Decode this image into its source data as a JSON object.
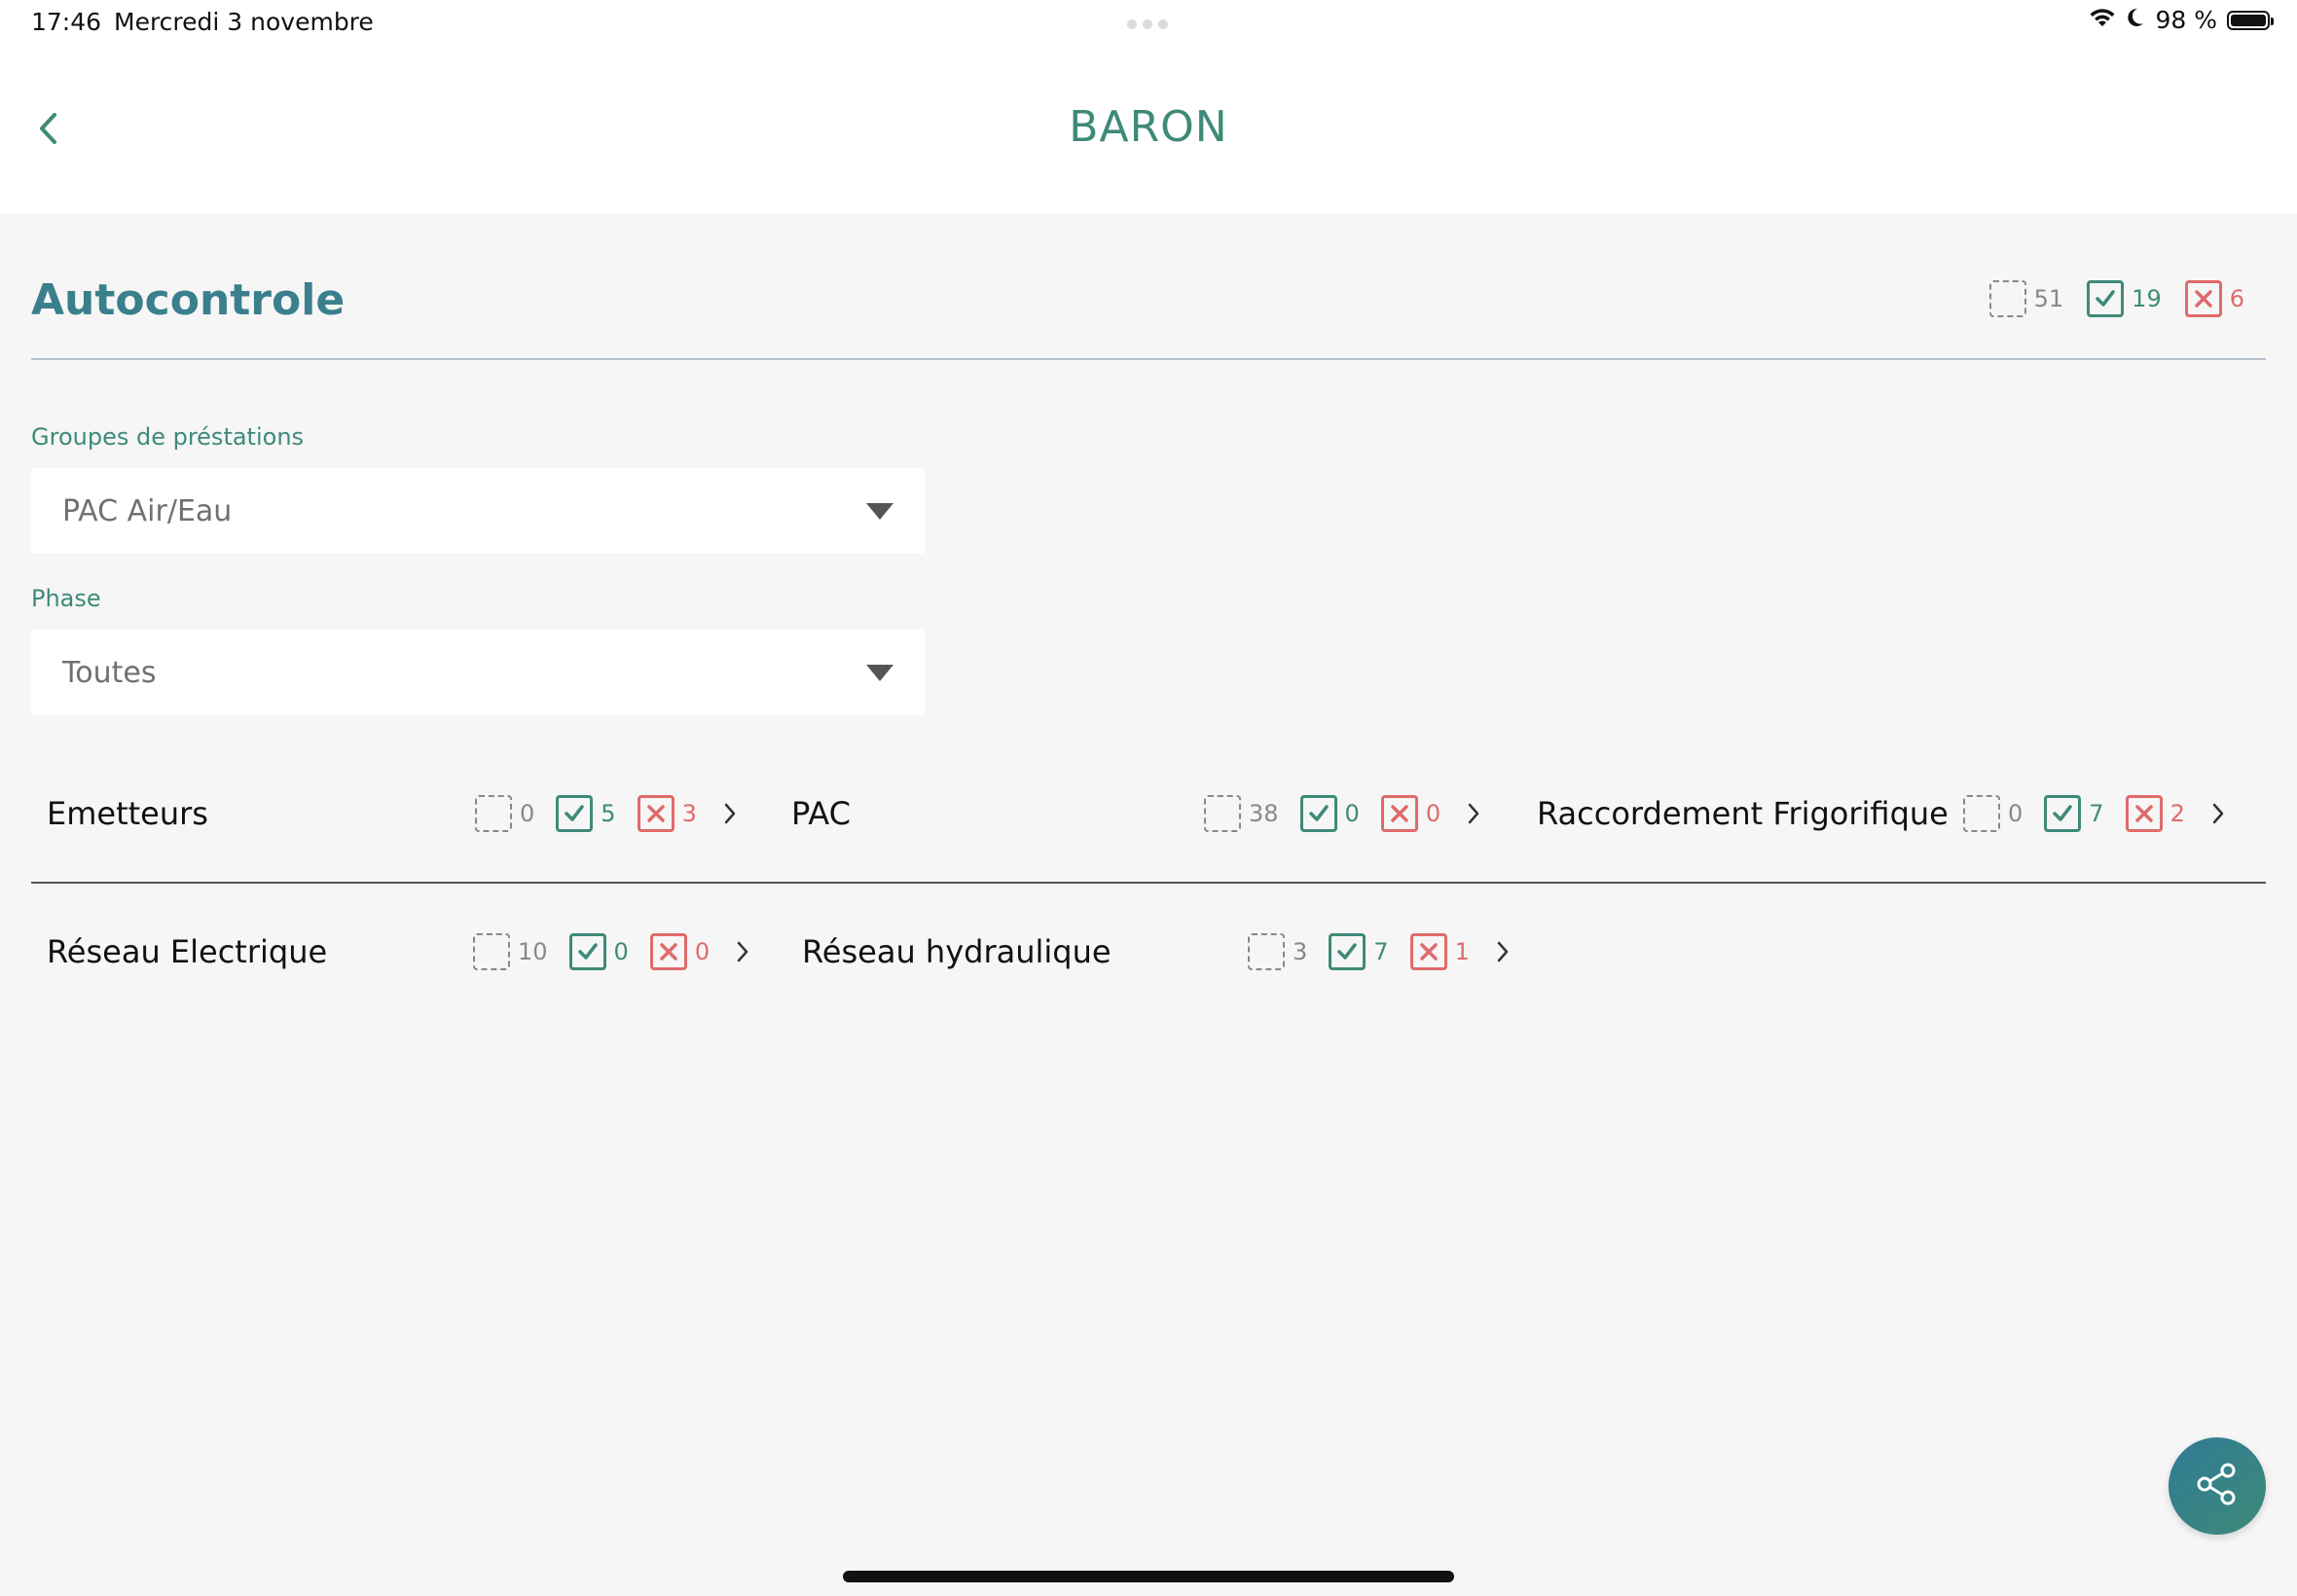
{
  "status_bar": {
    "time": "17:46",
    "date": "Mercredi 3 novembre",
    "battery": "98 %"
  },
  "header": {
    "title": "BARON"
  },
  "section": {
    "title": "Autocontrole",
    "summary": {
      "pending": "51",
      "ok": "19",
      "ko": "6"
    }
  },
  "filters": {
    "group_label": "Groupes de préstations",
    "group_value": "PAC Air/Eau",
    "phase_label": "Phase",
    "phase_value": "Toutes"
  },
  "categories": [
    {
      "name": "Emetteurs",
      "pending": "0",
      "ok": "5",
      "ko": "3"
    },
    {
      "name": "PAC",
      "pending": "38",
      "ok": "0",
      "ko": "0"
    },
    {
      "name": "Raccordement Frigorifique",
      "pending": "0",
      "ok": "7",
      "ko": "2"
    },
    {
      "name": "Réseau Electrique",
      "pending": "10",
      "ok": "0",
      "ko": "0"
    },
    {
      "name": "Réseau hydraulique",
      "pending": "3",
      "ok": "7",
      "ko": "1"
    }
  ],
  "colors": {
    "accent": "#3e8a78",
    "title_blue": "#3a7f8c",
    "ok": "#3e8a78",
    "ko": "#e06a6a",
    "pending": "#888888"
  },
  "icons": {
    "back": "chevron-left-icon",
    "share": "share-icon",
    "caret": "caret-down-icon",
    "wifi": "wifi-icon",
    "moon": "moon-icon",
    "battery": "battery-icon"
  }
}
